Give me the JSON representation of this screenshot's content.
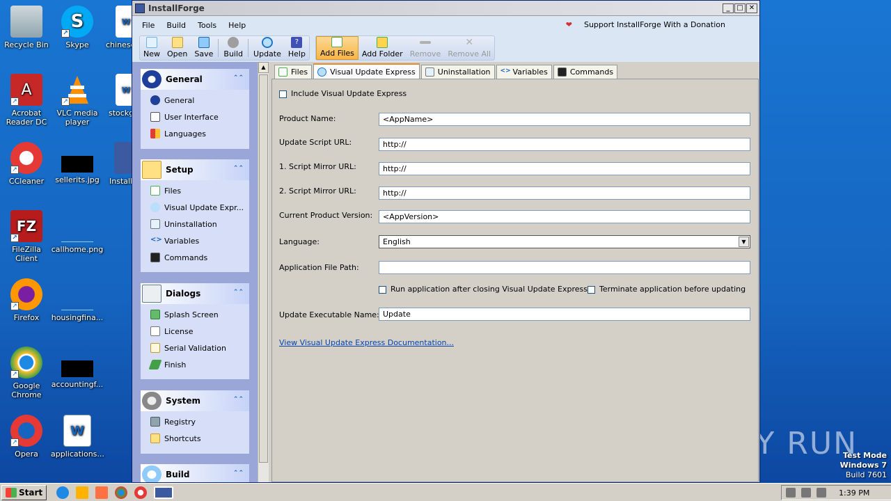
{
  "desktop": {
    "icons": [
      {
        "label": "Recycle Bin"
      },
      {
        "label": "Skype"
      },
      {
        "label": "chinese"
      },
      {
        "label": "Acrobat Reader DC"
      },
      {
        "label": "VLC media player"
      },
      {
        "label": "stockg"
      },
      {
        "label": "CCleaner"
      },
      {
        "label": "sellerits.jpg"
      },
      {
        "label": "Install"
      },
      {
        "label": "FileZilla Client"
      },
      {
        "label": "callhome.png"
      },
      {
        "label": "Firefox"
      },
      {
        "label": "housingfina..."
      },
      {
        "label": "Google Chrome"
      },
      {
        "label": "accountingf..."
      },
      {
        "label": "Opera"
      },
      {
        "label": "applications..."
      }
    ],
    "watermark": "ANY RUN",
    "testmode": {
      "line1": "Test Mode",
      "line2": "Windows 7",
      "line3": "Build 7601"
    }
  },
  "window": {
    "title": "InstallForge",
    "menu": [
      "File",
      "Build",
      "Tools",
      "Help"
    ],
    "donate": "Support InstallForge With a Donation",
    "toolbar": {
      "group1": [
        "New",
        "Open",
        "Save",
        "Build",
        "Update",
        "Help"
      ],
      "group2": [
        "Add Files",
        "Add Folder",
        "Remove",
        "Remove All"
      ]
    }
  },
  "sidebar": {
    "sections": [
      {
        "title": "General",
        "items": [
          "General",
          "User Interface",
          "Languages"
        ]
      },
      {
        "title": "Setup",
        "items": [
          "Files",
          "Visual Update Expr...",
          "Uninstallation",
          "Variables",
          "Commands"
        ]
      },
      {
        "title": "Dialogs",
        "items": [
          "Splash Screen",
          "License",
          "Serial Validation",
          "Finish"
        ]
      },
      {
        "title": "System",
        "items": [
          "Registry",
          "Shortcuts"
        ]
      },
      {
        "title": "Build",
        "items": []
      }
    ]
  },
  "tabs": [
    "Files",
    "Visual Update Express",
    "Uninstallation",
    "Variables",
    "Commands"
  ],
  "form": {
    "include_label": "Include Visual Update Express",
    "product_name_label": "Product Name:",
    "product_name_value": "<AppName>",
    "script_url_label": "Update Script URL:",
    "script_url_value": "http://",
    "mirror1_label": "1. Script Mirror URL:",
    "mirror1_value": "http://",
    "mirror2_label": "2. Script Mirror URL:",
    "mirror2_value": "http://",
    "version_label": "Current Product Version:",
    "version_value": "<AppVersion>",
    "language_label": "Language:",
    "language_value": "English",
    "app_path_label": "Application File Path:",
    "app_path_value": "",
    "run_after_label": "Run application after closing Visual Update Express",
    "terminate_label": "Terminate application before updating",
    "exe_name_label": "Update Executable Name:",
    "exe_name_value": "Update",
    "doc_link": "View Visual Update Express Documentation..."
  },
  "taskbar": {
    "start": "Start",
    "clock": "1:39 PM"
  }
}
